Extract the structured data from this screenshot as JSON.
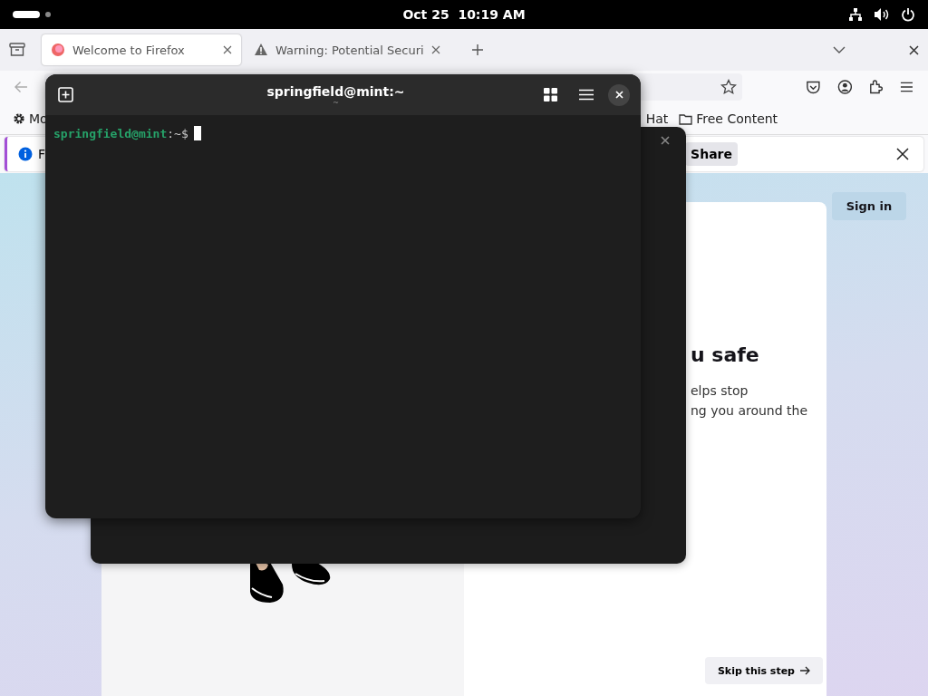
{
  "top_bar": {
    "date": "Oct 25",
    "time": "10:19 AM"
  },
  "browser": {
    "tabs": [
      {
        "title": "Welcome to Firefox",
        "kind": "firefox",
        "selected": true
      },
      {
        "title": "Warning: Potential Securi",
        "kind": "warning",
        "selected": false
      }
    ],
    "bookmarks": [
      {
        "label": "Mo",
        "kind": "gear"
      },
      {
        "label": "Hat",
        "kind": "plain"
      },
      {
        "label": "Free Content",
        "kind": "folder"
      }
    ],
    "notification": {
      "text": "F",
      "button": "Share"
    },
    "page": {
      "sign_in": "Sign in",
      "heading": "u safe",
      "body_lines": [
        "elps stop",
        "ng you around the"
      ],
      "skip": "Skip this step"
    }
  },
  "terminal": {
    "title": "springfield@mint:~",
    "subtitle": "~",
    "prompt_user": "springfield@mint",
    "prompt_path": ":~$"
  }
}
